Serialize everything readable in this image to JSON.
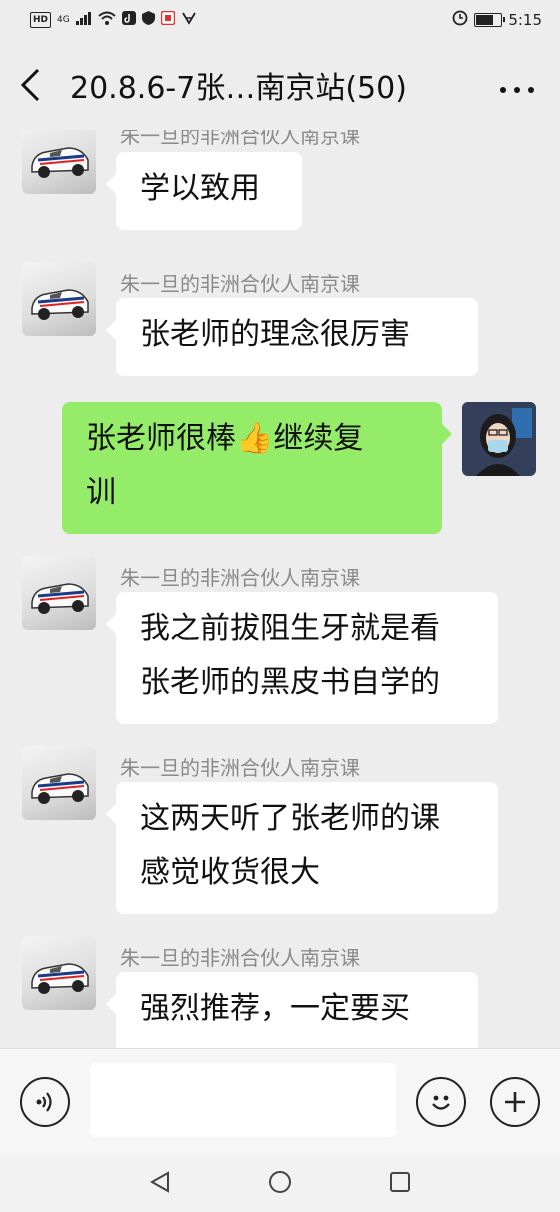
{
  "status_bar": {
    "left_badges": [
      "HD",
      "4G"
    ],
    "time": "5:15",
    "battery_level": 0.75
  },
  "header": {
    "title": "20.8.6-7张…南京站(50)"
  },
  "messages": [
    {
      "sender": "朱一旦的非洲合伙人南京课",
      "lines": [
        "学以致用"
      ],
      "mine": false
    },
    {
      "sender": "朱一旦的非洲合伙人南京课",
      "lines": [
        "张老师的理念很厉害"
      ],
      "mine": false
    },
    {
      "sender": "",
      "lines": [
        "张老师很棒👍继续复",
        "训"
      ],
      "mine": true
    },
    {
      "sender": "朱一旦的非洲合伙人南京课",
      "lines": [
        "我之前拔阻生牙就是看",
        "张老师的黑皮书自学的"
      ],
      "mine": false
    },
    {
      "sender": "朱一旦的非洲合伙人南京课",
      "lines": [
        "这两天听了张老师的课",
        "感觉收货很大"
      ],
      "mine": false
    },
    {
      "sender": "朱一旦的非洲合伙人南京课",
      "lines": [
        "强烈推荐，一定要买"
      ],
      "mine": false
    }
  ],
  "icons": {
    "back": "chevron-left-icon",
    "more": "more-icon",
    "voice": "voice-icon",
    "emoji": "emoji-icon",
    "plus": "plus-icon"
  },
  "colors": {
    "background": "#ededed",
    "own_bubble": "#95ec69",
    "other_bubble": "#ffffff"
  }
}
